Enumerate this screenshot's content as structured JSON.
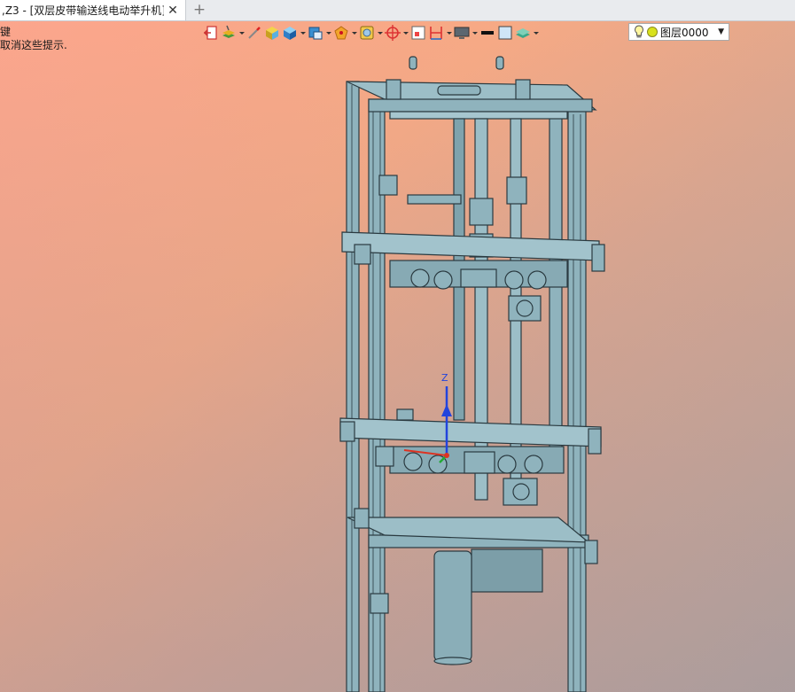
{
  "tab": {
    "title": ",Z3 - [双层皮带输送线电动举升机]",
    "close_glyph": "✕",
    "new_glyph": "+"
  },
  "hint": {
    "line1": "键",
    "line2": "取消这些提示."
  },
  "toolbar": {
    "items": [
      {
        "icon": "exit-sketch-icon",
        "caret": false
      },
      {
        "icon": "layers-paint-icon",
        "caret": true
      },
      {
        "icon": "magic-wand-icon",
        "caret": false
      },
      {
        "icon": "shaded-cube-icon",
        "caret": false
      },
      {
        "icon": "blue-cube-icon",
        "caret": true
      },
      {
        "icon": "view-cube-icon",
        "caret": true
      },
      {
        "icon": "render-mode-icon",
        "caret": true
      },
      {
        "icon": "display-filter-icon",
        "caret": true
      },
      {
        "icon": "target-crosshair-icon",
        "caret": true
      },
      {
        "icon": "frame-icon",
        "caret": false
      },
      {
        "icon": "dimension-icon",
        "caret": true
      },
      {
        "icon": "monitor-icon",
        "caret": true
      },
      {
        "icon": "line-style-icon",
        "caret": false
      },
      {
        "icon": "color-swatch-icon",
        "caret": false
      },
      {
        "icon": "layer-stack-icon",
        "caret": true
      }
    ]
  },
  "layer": {
    "value": "图层0000",
    "bulb_icon": "lightbulb-icon",
    "dot_color": "#d9e21c"
  },
  "colors": {
    "part_fill": "#8fb3bd",
    "part_stroke": "#2a3a40",
    "axis_z": "#2244dd",
    "axis_x": "#dd3322",
    "axis_y": "#22aa33"
  },
  "axis_label": "Z"
}
